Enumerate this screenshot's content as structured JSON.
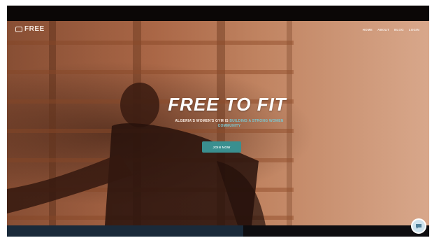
{
  "header": {
    "logo_text": "FREE",
    "nav": [
      "HOME",
      "ABOUT",
      "BLOG",
      "LOGIN"
    ]
  },
  "hero": {
    "headline": "FREE TO FIT",
    "subline_main": "ALGERIA'S WOMEN'S GYM IS",
    "subline_accent": "BUILDING A STRONG WOMEN",
    "subline_line2": "COMMUNITY",
    "cta_label": "JOIN NOW"
  },
  "colors": {
    "accent": "#3a8f8f",
    "hero_tint": "#b8704d"
  },
  "icons": {
    "logo": "free-logo-icon",
    "chat": "chat-icon"
  }
}
